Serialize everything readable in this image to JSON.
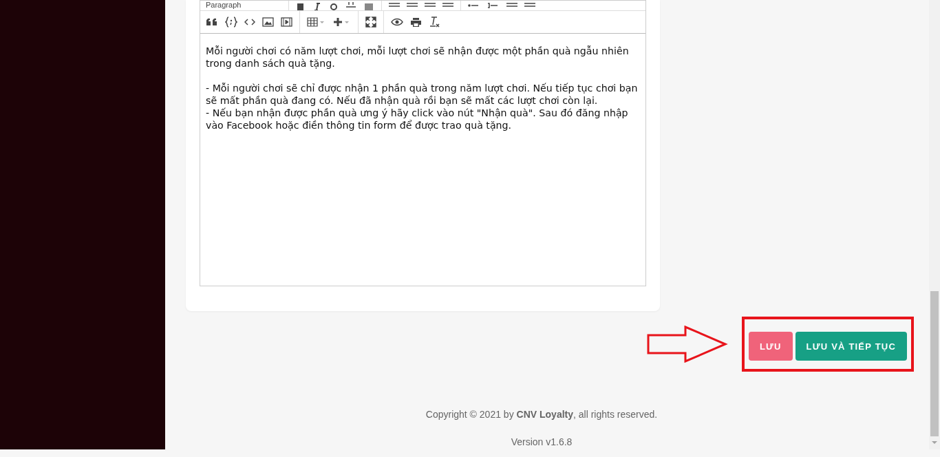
{
  "editor": {
    "format_dropdown": "Paragraph",
    "blocks": [
      [
        "Mỗi người chơi có năm lượt chơi, mỗi lượt chơi sẽ nhận được một phần quà ngẫu nhiên trong danh sách quà tặng."
      ],
      [
        "- Mỗi người chơi sẽ chỉ được nhận 1 phần quà trong năm lượt chơi. Nếu tiếp tục chơi bạn sẽ mất phần quà đang có. Nếu đã nhận quà rồi bạn sẽ mất các lượt chơi còn lại.",
        "- Nếu bạn nhận được phần quà ưng ý hãy click vào nút \"Nhận quà\". Sau đó đăng nhập vào Facebook hoặc điền thông tin form để được trao quà tặng."
      ]
    ]
  },
  "actions": [
    {
      "label": "LƯU",
      "kind": "secondary"
    },
    {
      "label": "LƯU VÀ TIẾP TỤC",
      "kind": "primary"
    }
  ],
  "footer": {
    "copyright": "Copyright © 2021 by **CNV Loyalty**, all rights reserved.",
    "version": "Version v1.6.8"
  }
}
